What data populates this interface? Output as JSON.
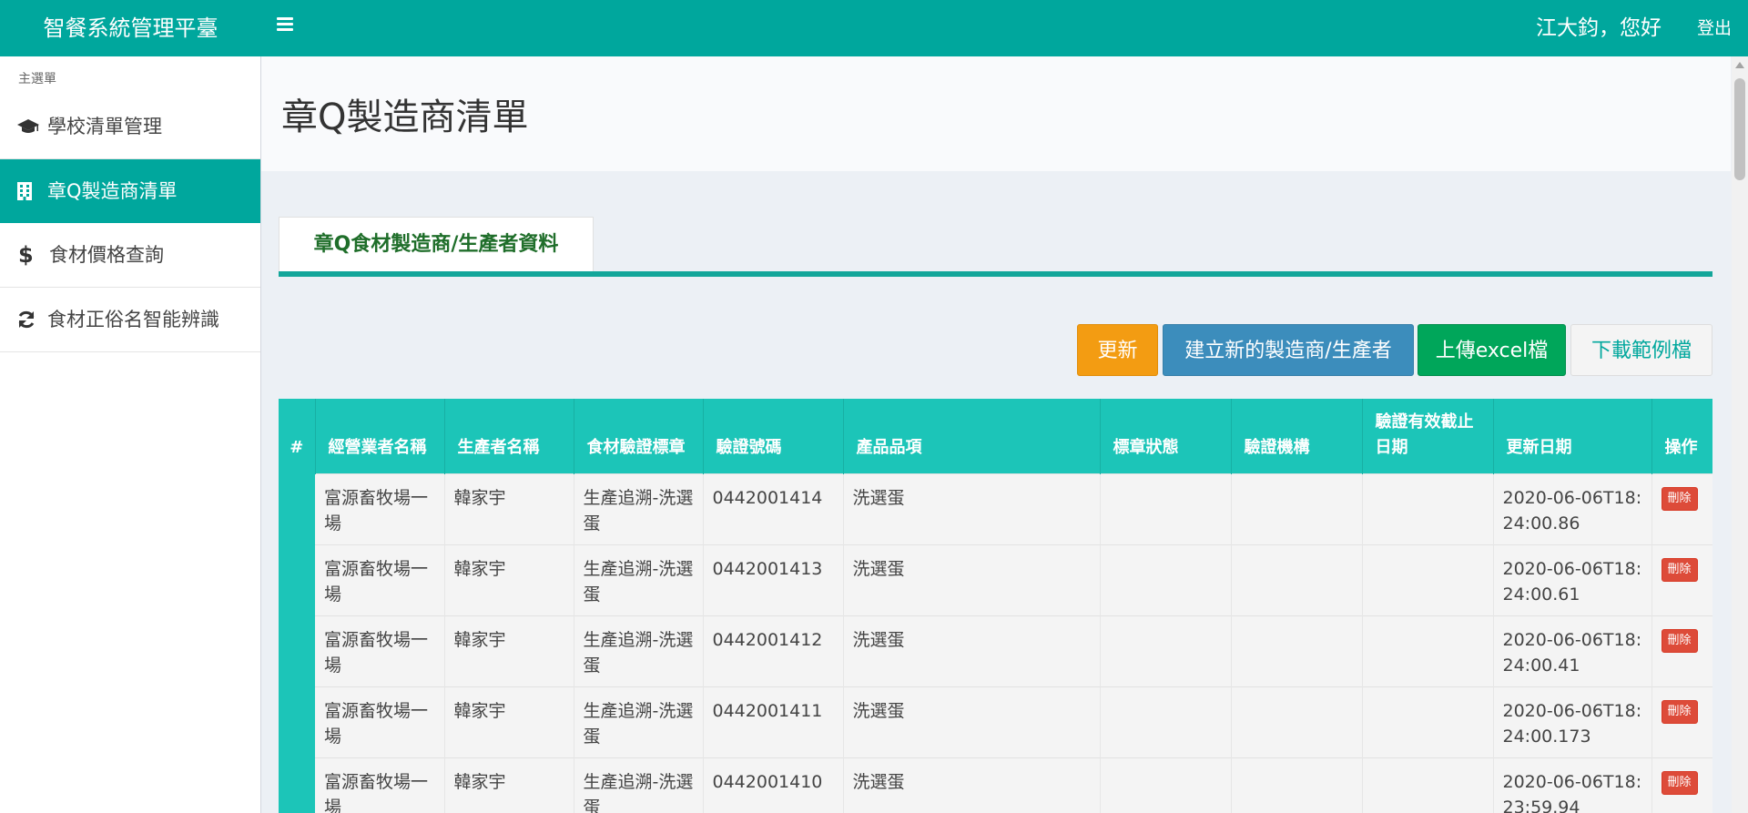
{
  "app": {
    "title": "智餐系統管理平臺",
    "greeting": "江大鈞，您好",
    "logout_label": "登出"
  },
  "sidebar": {
    "header": "主選單",
    "items": [
      {
        "label": "學校清單管理",
        "icon": "graduation-cap-icon"
      },
      {
        "label": "章Q製造商清單",
        "icon": "building-icon",
        "active": true
      },
      {
        "label": "食材價格查詢",
        "icon": "dollar-icon"
      },
      {
        "label": "食材正俗名智能辨識",
        "icon": "refresh-icon"
      }
    ]
  },
  "page": {
    "title": "章Q製造商清單",
    "tab_label": "章Q食材製造商/生產者資料"
  },
  "buttons": {
    "update": "更新",
    "create": "建立新的製造商/生產者",
    "upload": "上傳excel檔",
    "download": "下載範例檔"
  },
  "table": {
    "headers": [
      "#",
      "經營業者名稱",
      "生產者名稱",
      "食材驗證標章",
      "驗證號碼",
      "產品品項",
      "標章狀態",
      "驗證機構",
      "驗證有效截止日期",
      "更新日期",
      "操作"
    ],
    "delete_label": "刪除",
    "rows": [
      {
        "operator": "富源畜牧場一場",
        "producer": "韓家宇",
        "label": "生產追溯-洗選蛋",
        "cert_no": "0442001414",
        "product": "洗選蛋",
        "status": "",
        "agency": "",
        "expiry": "",
        "updated": "2020-06-06T18:24:00.86"
      },
      {
        "operator": "富源畜牧場一場",
        "producer": "韓家宇",
        "label": "生產追溯-洗選蛋",
        "cert_no": "0442001413",
        "product": "洗選蛋",
        "status": "",
        "agency": "",
        "expiry": "",
        "updated": "2020-06-06T18:24:00.61"
      },
      {
        "operator": "富源畜牧場一場",
        "producer": "韓家宇",
        "label": "生產追溯-洗選蛋",
        "cert_no": "0442001412",
        "product": "洗選蛋",
        "status": "",
        "agency": "",
        "expiry": "",
        "updated": "2020-06-06T18:24:00.41"
      },
      {
        "operator": "富源畜牧場一場",
        "producer": "韓家宇",
        "label": "生產追溯-洗選蛋",
        "cert_no": "0442001411",
        "product": "洗選蛋",
        "status": "",
        "agency": "",
        "expiry": "",
        "updated": "2020-06-06T18:24:00.173"
      },
      {
        "operator": "富源畜牧場一場",
        "producer": "韓家宇",
        "label": "生產追溯-洗選蛋",
        "cert_no": "0442001410",
        "product": "洗選蛋",
        "status": "",
        "agency": "",
        "expiry": "",
        "updated": "2020-06-06T18:23:59.94"
      }
    ]
  },
  "colors": {
    "primary": "#00a79d",
    "table_header": "#1cc5b8",
    "update_button": "#f39c12",
    "create_button": "#3c8dbc",
    "upload_button": "#00a65a",
    "delete_button": "#dd4b39"
  }
}
